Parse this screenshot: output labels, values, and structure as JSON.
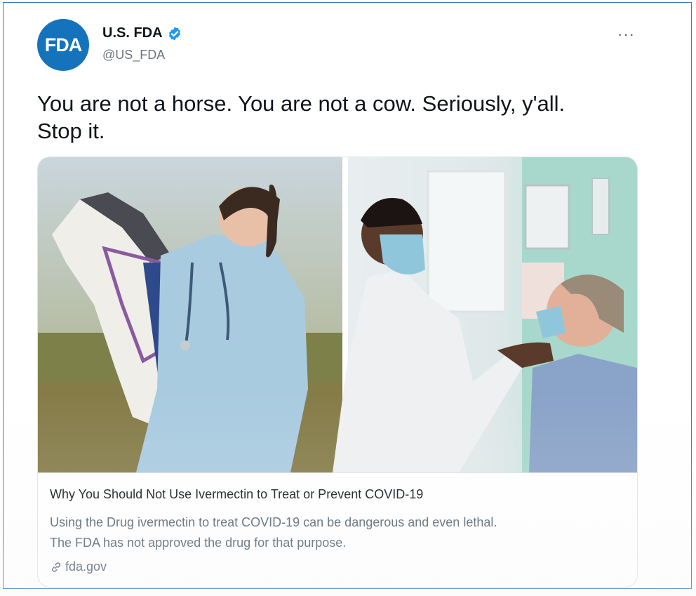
{
  "tweet": {
    "avatar_text": "FDA",
    "display_name": "U.S. FDA",
    "handle": "@US_FDA",
    "more_label": "···",
    "text_line1": "You are not a horse. You are not a cow. Seriously, y'all.",
    "text_line2": "Stop it."
  },
  "card": {
    "title": "Why You Should Not Use Ivermectin to Treat or Prevent COVID-19",
    "desc_line1": "Using the Drug ivermectin to treat COVID-19 can be dangerous and even lethal.",
    "desc_line2": "The FDA has not approved the drug for that purpose.",
    "domain": "fda.gov"
  },
  "colors": {
    "brand": "#1573bc",
    "verified": "#1d9bf0",
    "text": "#0f1419",
    "muted": "#536471"
  }
}
